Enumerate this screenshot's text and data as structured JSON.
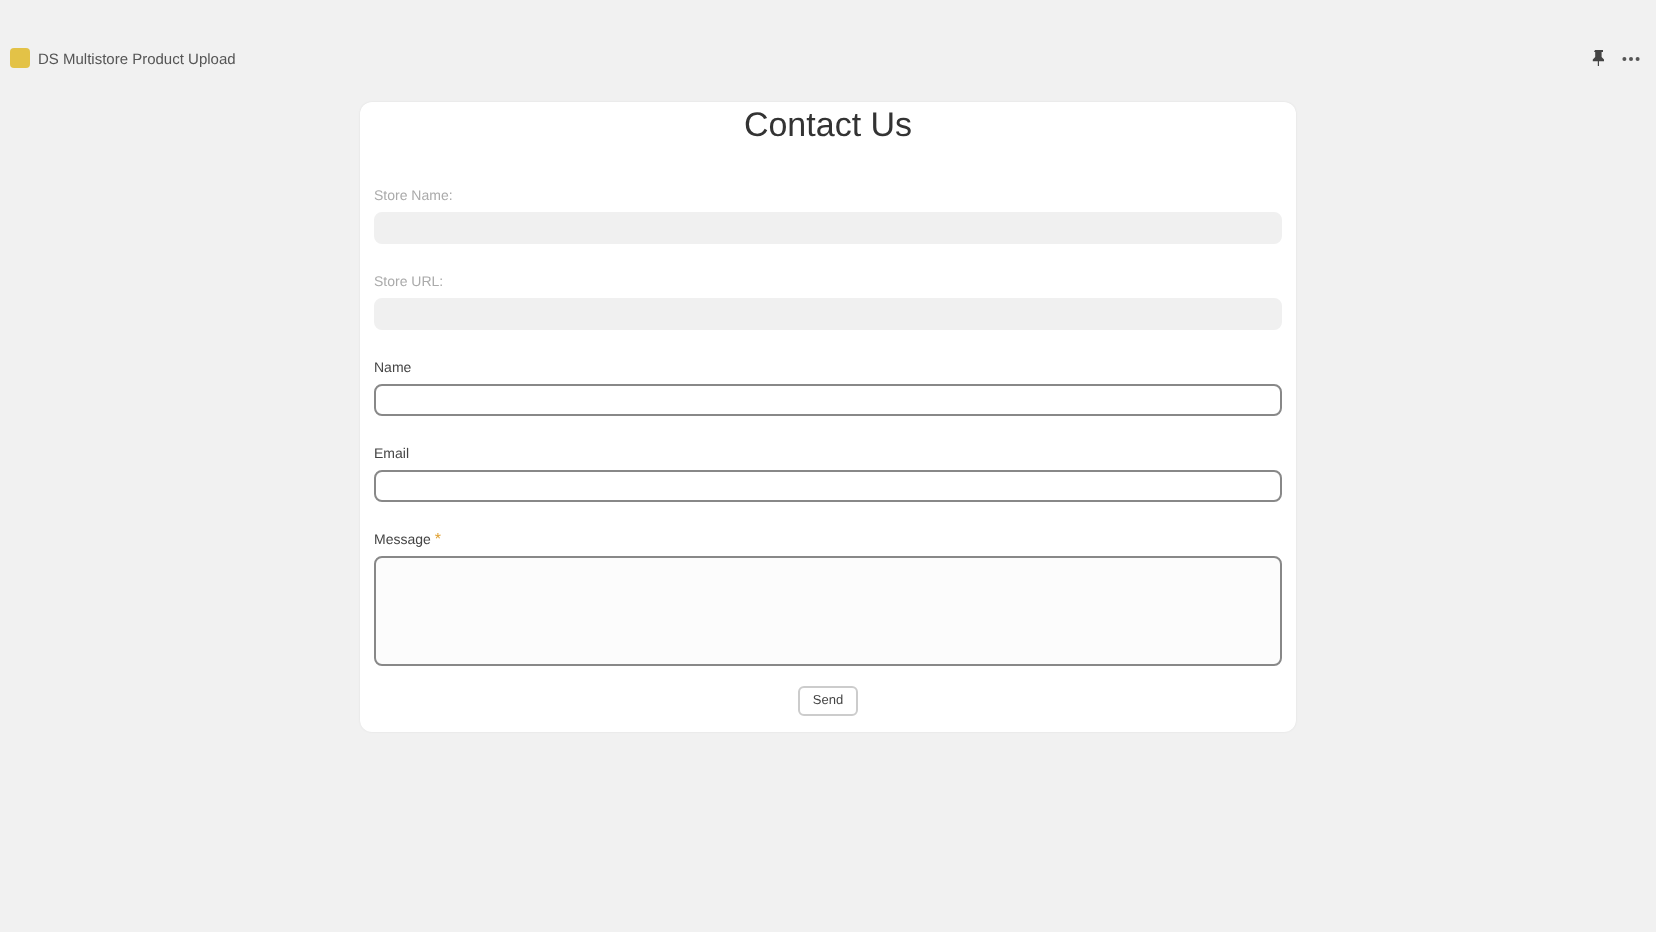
{
  "app": {
    "title": "DS Multistore Product Upload"
  },
  "form": {
    "title": "Contact Us",
    "fields": [
      {
        "label": "Store Name:",
        "kind": "input",
        "disabled": true,
        "required": false
      },
      {
        "label": "Store URL:",
        "kind": "input",
        "disabled": true,
        "required": false
      },
      {
        "label": "Name",
        "kind": "input",
        "disabled": false,
        "required": false
      },
      {
        "label": "Email",
        "kind": "input",
        "disabled": false,
        "required": false
      },
      {
        "label": "Message",
        "kind": "textarea",
        "disabled": false,
        "required": true
      }
    ],
    "required_mark": "*",
    "submit": "Send"
  }
}
